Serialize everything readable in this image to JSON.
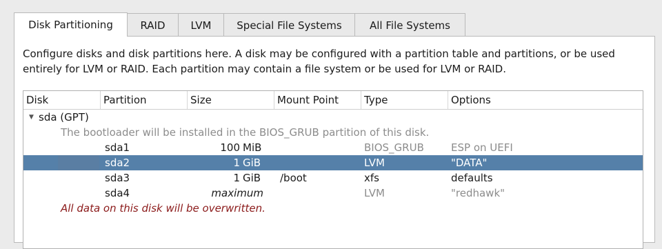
{
  "tabs": [
    {
      "label": "Disk Partitioning",
      "active": true
    },
    {
      "label": "RAID",
      "active": false
    },
    {
      "label": "LVM",
      "active": false
    },
    {
      "label": "Special File Systems",
      "active": false
    },
    {
      "label": "All File Systems",
      "active": false
    }
  ],
  "description": "Configure disks and disk partitions here.  A disk may be configured with a partition table and partitions, or be used entirely for LVM or RAID.  Each partition may contain a file system or be used for LVM or RAID.",
  "table": {
    "columns": [
      "Disk",
      "Partition",
      "Size",
      "Mount Point",
      "Type",
      "Options"
    ],
    "disk": {
      "label": "sda (GPT)",
      "expander_icon": "triangle-down",
      "bootloader_note": "The bootloader will be installed in the BIOS_GRUB partition of this disk.",
      "warning": "All data on this disk will be overwritten."
    },
    "partitions": [
      {
        "name": "sda1",
        "size_num": "100",
        "size_unit": "MiB",
        "mount": "",
        "type": "BIOS_GRUB",
        "options": "ESP on UEFI",
        "muted": true,
        "selected": false
      },
      {
        "name": "sda2",
        "size_num": "1",
        "size_unit": "GiB",
        "mount": "",
        "type": "LVM",
        "options": "\"DATA\"",
        "muted": true,
        "selected": true
      },
      {
        "name": "sda3",
        "size_num": "1",
        "size_unit": "GiB",
        "mount": "/boot",
        "type": "xfs",
        "options": "defaults",
        "muted": false,
        "selected": false
      },
      {
        "name": "sda4",
        "size_num": "maximum",
        "size_unit": "",
        "mount": "",
        "type": "LVM",
        "options": "\"redhawk\"",
        "muted": true,
        "selected": false,
        "italic_size": true
      }
    ]
  },
  "colors": {
    "selection": "#5580a9",
    "warning": "#8b1a1a",
    "muted": "#8c8c8c"
  }
}
